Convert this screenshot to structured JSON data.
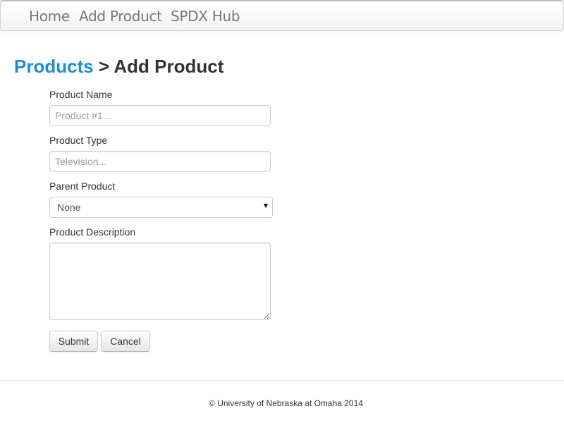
{
  "navbar": {
    "items": [
      {
        "label": "Home"
      },
      {
        "label": "Add Product"
      },
      {
        "label": "SPDX Hub"
      }
    ]
  },
  "breadcrumb": {
    "parent": "Products",
    "separator": " > ",
    "current": "Add Product"
  },
  "form": {
    "product_name": {
      "label": "Product Name",
      "value": "",
      "placeholder": "Product #1..."
    },
    "product_type": {
      "label": "Product Type",
      "value": "",
      "placeholder": "Television..."
    },
    "parent_product": {
      "label": "Parent Product",
      "selected": "None",
      "icon": "chevron-down-icon"
    },
    "product_description": {
      "label": "Product Description",
      "value": ""
    },
    "submit_label": "Submit",
    "cancel_label": "Cancel"
  },
  "footer": {
    "text": "© University of Nebraska at Omaha 2014"
  },
  "colors": {
    "link": "#1f8dd6",
    "text": "#333333",
    "nav_text": "#777777",
    "border": "#cccccc"
  }
}
